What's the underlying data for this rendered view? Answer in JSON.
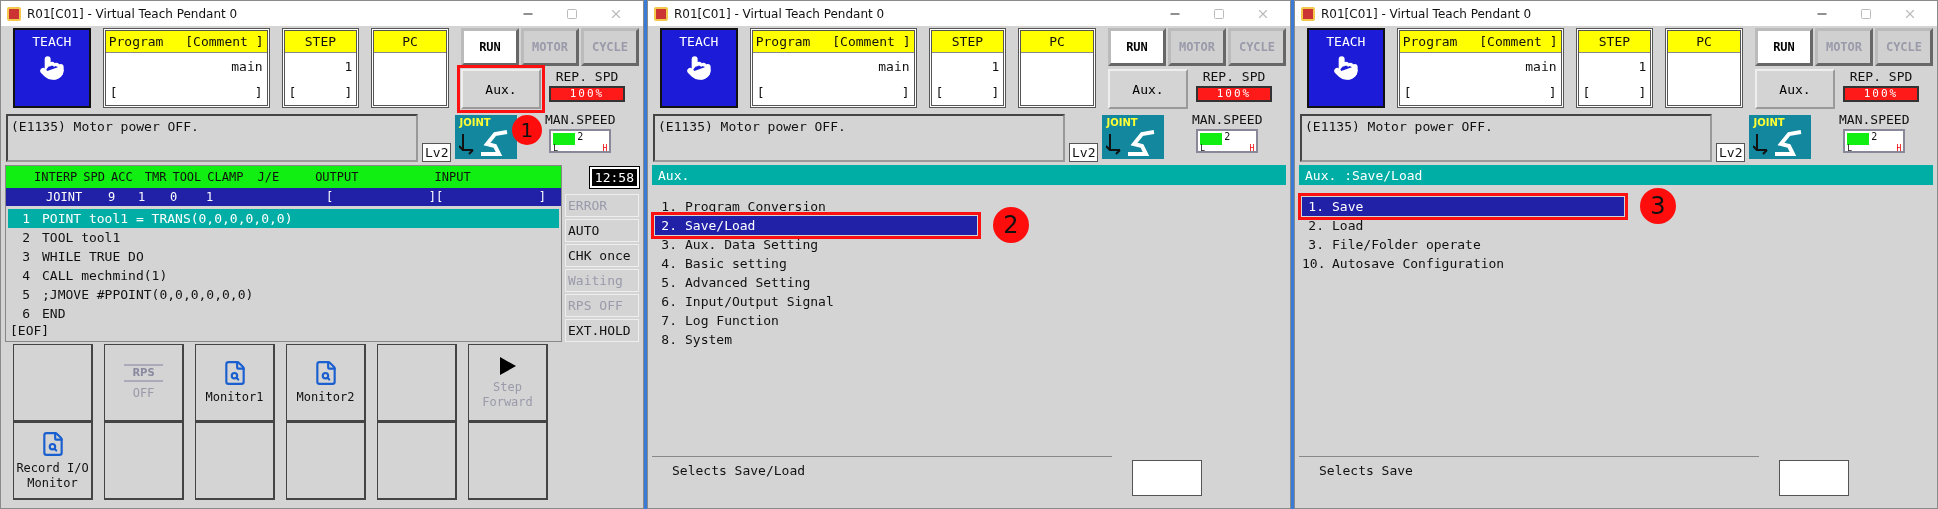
{
  "windows": [
    {
      "kind": "program",
      "title": "R01[C01] - Virtual Teach Pendant 0",
      "mode": "TEACH",
      "program": {
        "label": "Program",
        "comment_label": "[Comment ]",
        "value": "main",
        "bracket_open": "[",
        "bracket_close": "]"
      },
      "step": {
        "label": "STEP",
        "value": "1",
        "bracket_open": "[",
        "bracket_close": "]"
      },
      "pc": {
        "label": "PC"
      },
      "status_buttons": [
        {
          "label": "RUN",
          "on": true
        },
        {
          "label": "MOTOR",
          "on": false
        },
        {
          "label": "CYCLE",
          "on": false
        }
      ],
      "aux_button": {
        "label": "Aux.",
        "callout": "1"
      },
      "rep_speed": {
        "label": "REP. SPD",
        "value": "100%"
      },
      "message": "(E1135) Motor power OFF.",
      "access_level": "Lv2",
      "coord_mode": "JOINT",
      "man_speed": {
        "label": "MAN.SPEED",
        "value": "2",
        "level": 0.38,
        "low": "L",
        "high": "H"
      },
      "status_header": [
        "INTERP",
        "SPD",
        "ACC",
        "TMR",
        "TOOL",
        "CLAMP",
        "J/E",
        "OUTPUT",
        "INPUT"
      ],
      "status_values": [
        "JOINT",
        "9",
        "1",
        "0",
        "1"
      ],
      "output": [
        "[",
        "]"
      ],
      "input": [
        "[",
        "]"
      ],
      "clock": "12:58",
      "program_lines": [
        {
          "number": "1",
          "code": "POINT tool1 = TRANS(0,0,0,0,0,0)",
          "selected": true
        },
        {
          "number": "2",
          "code": "TOOL tool1",
          "selected": false
        },
        {
          "number": "3",
          "code": "WHILE TRUE DO",
          "selected": false
        },
        {
          "number": "4",
          "code": "CALL mechmind(1)",
          "selected": false
        },
        {
          "number": "5",
          "code": ";JMOVE #PPOINT(0,0,0,0,0,0)",
          "selected": false
        },
        {
          "number": "6",
          "code": "END",
          "selected": false
        }
      ],
      "eof": "[EOF]",
      "side_buttons": [
        {
          "label": "ERROR",
          "disabled": true
        },
        {
          "label": "AUTO",
          "disabled": false
        },
        {
          "label": "CHK once",
          "disabled": false
        },
        {
          "label": "Waiting",
          "disabled": true
        },
        {
          "label": "RPS OFF",
          "disabled": true
        },
        {
          "label": "EXT.HOLD",
          "disabled": false
        }
      ],
      "function_keys": [
        {
          "kind": "blank"
        },
        {
          "kind": "rps",
          "badge": "RPS",
          "label": "OFF",
          "disabled": true
        },
        {
          "kind": "monitor",
          "label": "Monitor1",
          "disabled": false
        },
        {
          "kind": "monitor",
          "label": "Monitor2",
          "disabled": false
        },
        {
          "kind": "blank"
        },
        {
          "kind": "step",
          "label": "Step Forward",
          "disabled": true
        },
        {
          "kind": "record",
          "label": "Record I/O Monitor",
          "disabled": false
        },
        {
          "kind": "blank"
        },
        {
          "kind": "blank"
        },
        {
          "kind": "blank"
        },
        {
          "kind": "blank"
        },
        {
          "kind": "blank"
        }
      ]
    },
    {
      "kind": "menu",
      "title": "R01[C01] - Virtual Teach Pendant 0",
      "mode": "TEACH",
      "program": {
        "label": "Program",
        "comment_label": "[Comment ]",
        "value": "main",
        "bracket_open": "[",
        "bracket_close": "]"
      },
      "step": {
        "label": "STEP",
        "value": "1",
        "bracket_open": "[",
        "bracket_close": "]"
      },
      "pc": {
        "label": "PC"
      },
      "status_buttons": [
        {
          "label": "RUN",
          "on": true
        },
        {
          "label": "MOTOR",
          "on": false
        },
        {
          "label": "CYCLE",
          "on": false
        }
      ],
      "aux_button": {
        "label": "Aux."
      },
      "rep_speed": {
        "label": "REP. SPD",
        "value": "100%"
      },
      "message": "(E1135) Motor power OFF.",
      "access_level": "Lv2",
      "coord_mode": "JOINT",
      "man_speed": {
        "label": "MAN.SPEED",
        "value": "2",
        "level": 0.38,
        "low": "L",
        "high": "H"
      },
      "breadcrumb": "Aux.",
      "menu_items": [
        {
          "number": "1.",
          "label": "Program Conversion",
          "selected": false
        },
        {
          "number": "2.",
          "label": "Save/Load",
          "selected": true,
          "callout": "2"
        },
        {
          "number": "3.",
          "label": "Aux. Data Setting",
          "selected": false
        },
        {
          "number": "4.",
          "label": "Basic setting",
          "selected": false
        },
        {
          "number": "5.",
          "label": "Advanced Setting",
          "selected": false
        },
        {
          "number": "6.",
          "label": "Input/Output Signal",
          "selected": false
        },
        {
          "number": "7.",
          "label": "Log Function",
          "selected": false
        },
        {
          "number": "8.",
          "label": "System",
          "selected": false
        }
      ],
      "description": "Selects Save/Load"
    },
    {
      "kind": "menu",
      "title": "R01[C01] - Virtual Teach Pendant 0",
      "mode": "TEACH",
      "program": {
        "label": "Program",
        "comment_label": "[Comment ]",
        "value": "main",
        "bracket_open": "[",
        "bracket_close": "]"
      },
      "step": {
        "label": "STEP",
        "value": "1",
        "bracket_open": "[",
        "bracket_close": "]"
      },
      "pc": {
        "label": "PC"
      },
      "status_buttons": [
        {
          "label": "RUN",
          "on": true
        },
        {
          "label": "MOTOR",
          "on": false
        },
        {
          "label": "CYCLE",
          "on": false
        }
      ],
      "aux_button": {
        "label": "Aux."
      },
      "rep_speed": {
        "label": "REP. SPD",
        "value": "100%"
      },
      "message": "(E1135) Motor power OFF.",
      "access_level": "Lv2",
      "coord_mode": "JOINT",
      "man_speed": {
        "label": "MAN.SPEED",
        "value": "2",
        "level": 0.38,
        "low": "L",
        "high": "H"
      },
      "breadcrumb": "Aux. :Save/Load",
      "menu_items": [
        {
          "number": "1.",
          "label": "Save",
          "selected": true,
          "callout": "3"
        },
        {
          "number": "2.",
          "label": "Load",
          "selected": false
        },
        {
          "number": "3.",
          "label": "File/Folder operate",
          "selected": false
        },
        {
          "number": "10.",
          "label": "Autosave Configuration",
          "selected": false
        }
      ],
      "description": "Selects Save"
    }
  ]
}
